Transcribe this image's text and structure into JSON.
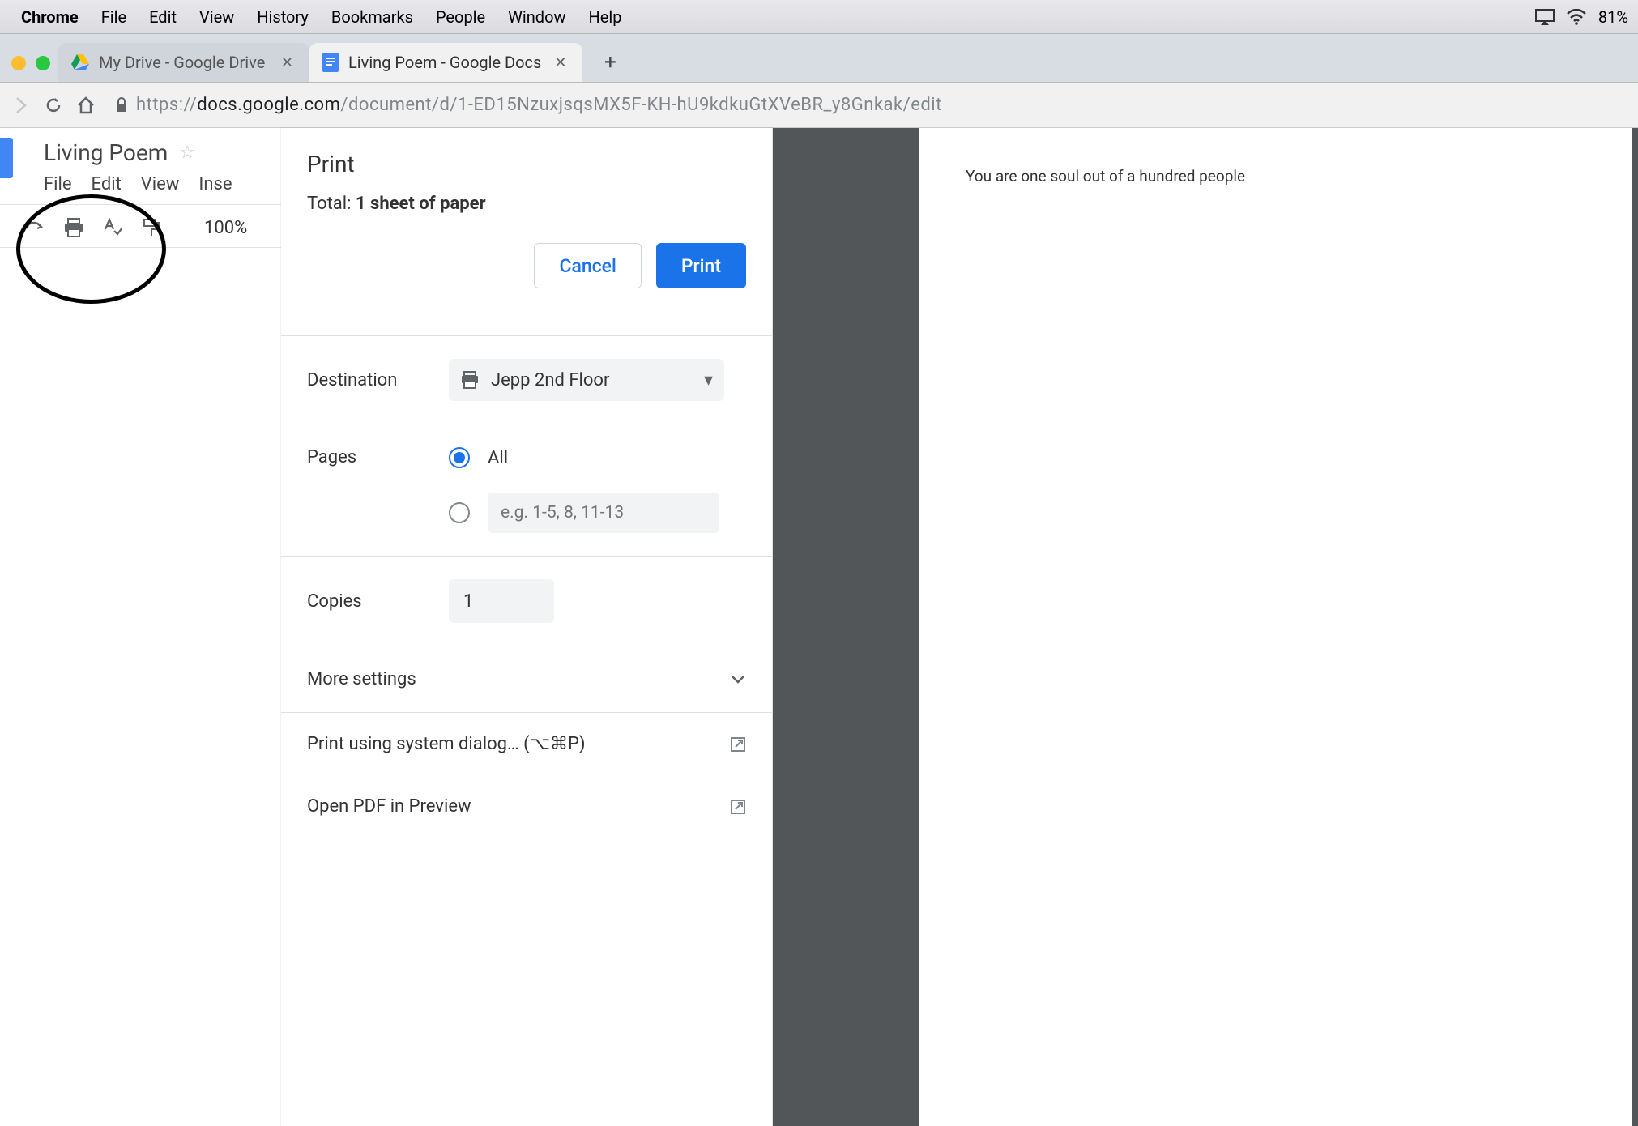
{
  "menubar": {
    "app": "Chrome",
    "items": [
      "File",
      "Edit",
      "View",
      "History",
      "Bookmarks",
      "People",
      "Window",
      "Help"
    ],
    "battery": "81%"
  },
  "tabs": {
    "tab1": "My Drive - Google Drive",
    "tab2": "Living Poem - Google Docs"
  },
  "url": {
    "prefix": "https://",
    "domain": "docs.google.com",
    "path": "/document/d/1-ED15NzuxjsqsMX5F-KH-hU9kdkuGtXVeBR_y8Gnkak/edit"
  },
  "doc": {
    "title": "Living Poem",
    "menus": [
      "File",
      "Edit",
      "View",
      "Inse"
    ],
    "zoom": "100%"
  },
  "print": {
    "title": "Print",
    "total_prefix": "Total: ",
    "total_bold": "1 sheet of paper",
    "cancel": "Cancel",
    "print_btn": "Print",
    "destination_label": "Destination",
    "destination_value": "Jepp 2nd Floor",
    "pages_label": "Pages",
    "pages_all": "All",
    "pages_placeholder": "e.g. 1-5, 8, 11-13",
    "copies_label": "Copies",
    "copies_value": "1",
    "more": "More settings",
    "system_dialog": "Print using system dialog… (⌥⌘P)",
    "open_pdf": "Open PDF in Preview"
  },
  "preview": {
    "content": "You are one soul out of a hundred people"
  }
}
